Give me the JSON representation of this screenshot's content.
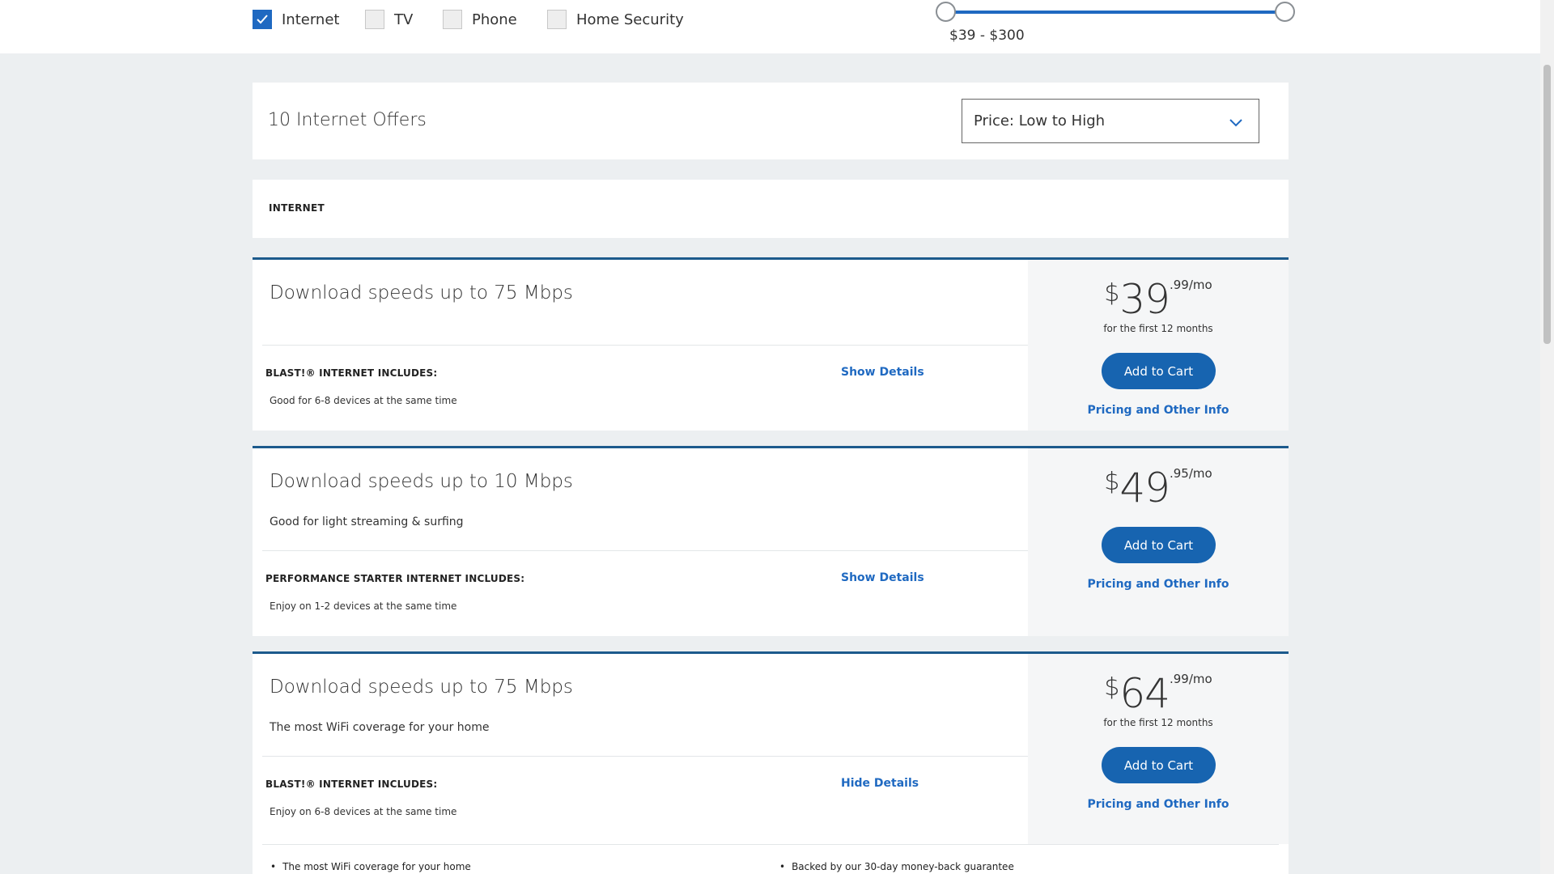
{
  "filters": {
    "checkboxes": [
      {
        "label": "Internet",
        "checked": true
      },
      {
        "label": "TV",
        "checked": false
      },
      {
        "label": "Phone",
        "checked": false
      },
      {
        "label": "Home Security",
        "checked": false
      }
    ],
    "price_range_label": "$39 - $300"
  },
  "results": {
    "count_label": "10 Internet Offers",
    "sort_value": "Price: Low to High"
  },
  "category_label": "INTERNET",
  "offers": [
    {
      "title": "Download speeds up to 75 Mbps",
      "subtitle": "",
      "includes_label": "BLAST!® INTERNET INCLUDES:",
      "feature": "Good for 6-8 devices at the same time",
      "toggle_label": "Show Details",
      "price_currency": "$",
      "price_dollars": "39",
      "price_cents": ".99/mo",
      "price_note": "for the first 12 months",
      "cart_label": "Add to Cart",
      "pricing_link": "Pricing and Other Info"
    },
    {
      "title": "Download speeds up to 10 Mbps",
      "subtitle": "Good for light streaming & surfing",
      "includes_label": "PERFORMANCE STARTER INTERNET INCLUDES:",
      "feature": "Enjoy on 1-2 devices at the same time",
      "toggle_label": "Show Details",
      "price_currency": "$",
      "price_dollars": "49",
      "price_cents": ".95/mo",
      "price_note": "",
      "cart_label": "Add to Cart",
      "pricing_link": "Pricing and Other Info"
    },
    {
      "title": "Download speeds up to 75 Mbps",
      "subtitle": "The most WiFi coverage for your home",
      "includes_label": "BLAST!® INTERNET INCLUDES:",
      "feature": "Enjoy on 6-8 devices at the same time",
      "toggle_label": "Hide Details",
      "price_currency": "$",
      "price_dollars": "64",
      "price_cents": ".99/mo",
      "price_note": "for the first 12 months",
      "cart_label": "Add to Cart",
      "pricing_link": "Pricing and Other Info",
      "details": [
        "The most WiFi coverage for your home",
        "Backed by our 30-day money-back guarantee"
      ]
    }
  ],
  "colors": {
    "accent": "#1f69c1",
    "button": "#1764b0",
    "offer_border": "#1c5a8c",
    "page_bg": "#eceff1"
  }
}
